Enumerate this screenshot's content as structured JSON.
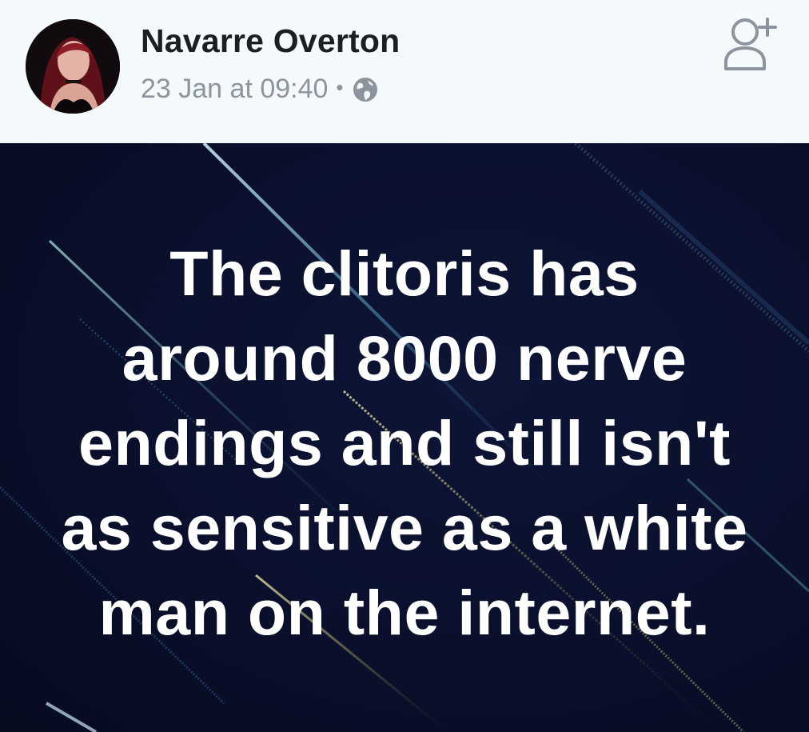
{
  "post": {
    "author": {
      "name": "Navarre Overton"
    },
    "meta": {
      "date": "23 Jan at 09:40",
      "separator": "•",
      "privacy_icon": "globe-icon"
    },
    "actions": {
      "add_friend_icon": "add-friend-icon"
    },
    "image_text": {
      "lines": [
        "The clitoris has",
        "around 8000 nerve",
        "endings and still isn't",
        "as sensitive as a white",
        "man on the internet."
      ]
    }
  },
  "colors": {
    "header_bg": "#f4fafb",
    "name_text": "#1c1e21",
    "meta_text": "#8d949e",
    "image_bg": "#0a102c",
    "quote_text": "#ffffff"
  }
}
